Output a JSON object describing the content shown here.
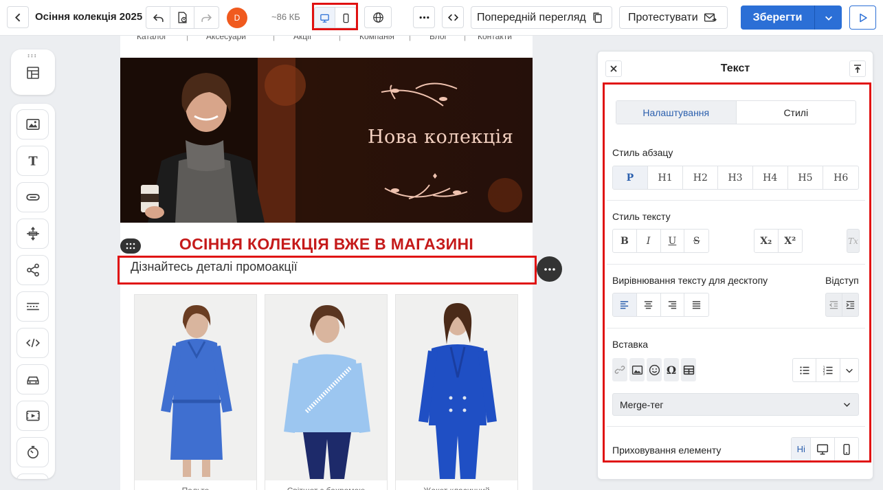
{
  "header": {
    "title": "Осіння колекція 2025",
    "avatar_initial": "D",
    "size_label": "~86 КБ",
    "preview_label": "Попередній перегляд",
    "test_label": "Протестувати",
    "save_label": "Зберегти"
  },
  "canvas": {
    "nav_items": [
      "Каталог",
      "Аксесуари",
      "Акції",
      "Компанія",
      "Блог",
      "Контакти"
    ],
    "banner_title": "Нова колекція",
    "headline": "ОСІННЯ КОЛЕКЦІЯ ВЖЕ В МАГАЗИНІ",
    "subline": "Дізнайтесь деталі промоакції",
    "products": [
      {
        "caption": "Пальто",
        "color": "#3f6fd0"
      },
      {
        "caption": "Світшот з бахромою",
        "color": "#9cc6f0"
      },
      {
        "caption": "Жакет класичний",
        "color": "#1f4fc4"
      }
    ]
  },
  "panel": {
    "title": "Текст",
    "tabs": [
      "Налаштування",
      "Стилі"
    ],
    "paragraph_style_label": "Стиль абзацу",
    "paragraph_styles": [
      "P",
      "H1",
      "H2",
      "H3",
      "H4",
      "H5",
      "H6"
    ],
    "text_style_label": "Стиль тексту",
    "text_styles": [
      "B",
      "I",
      "U",
      "S"
    ],
    "script_styles": [
      "X₂",
      "X²"
    ],
    "clear_format": "Tx",
    "align_label": "Вирівнювання тексту для десктопу",
    "indent_label": "Відступ",
    "insert_label": "Вставка",
    "merge_tag_label": "Merge-тег",
    "hide_label": "Приховування елементу",
    "hide_none": "Ні"
  },
  "colors": {
    "accent": "#2b6fd6",
    "highlight": "#e01010",
    "headline": "#c51a1a",
    "avatar": "#f05a1e"
  }
}
